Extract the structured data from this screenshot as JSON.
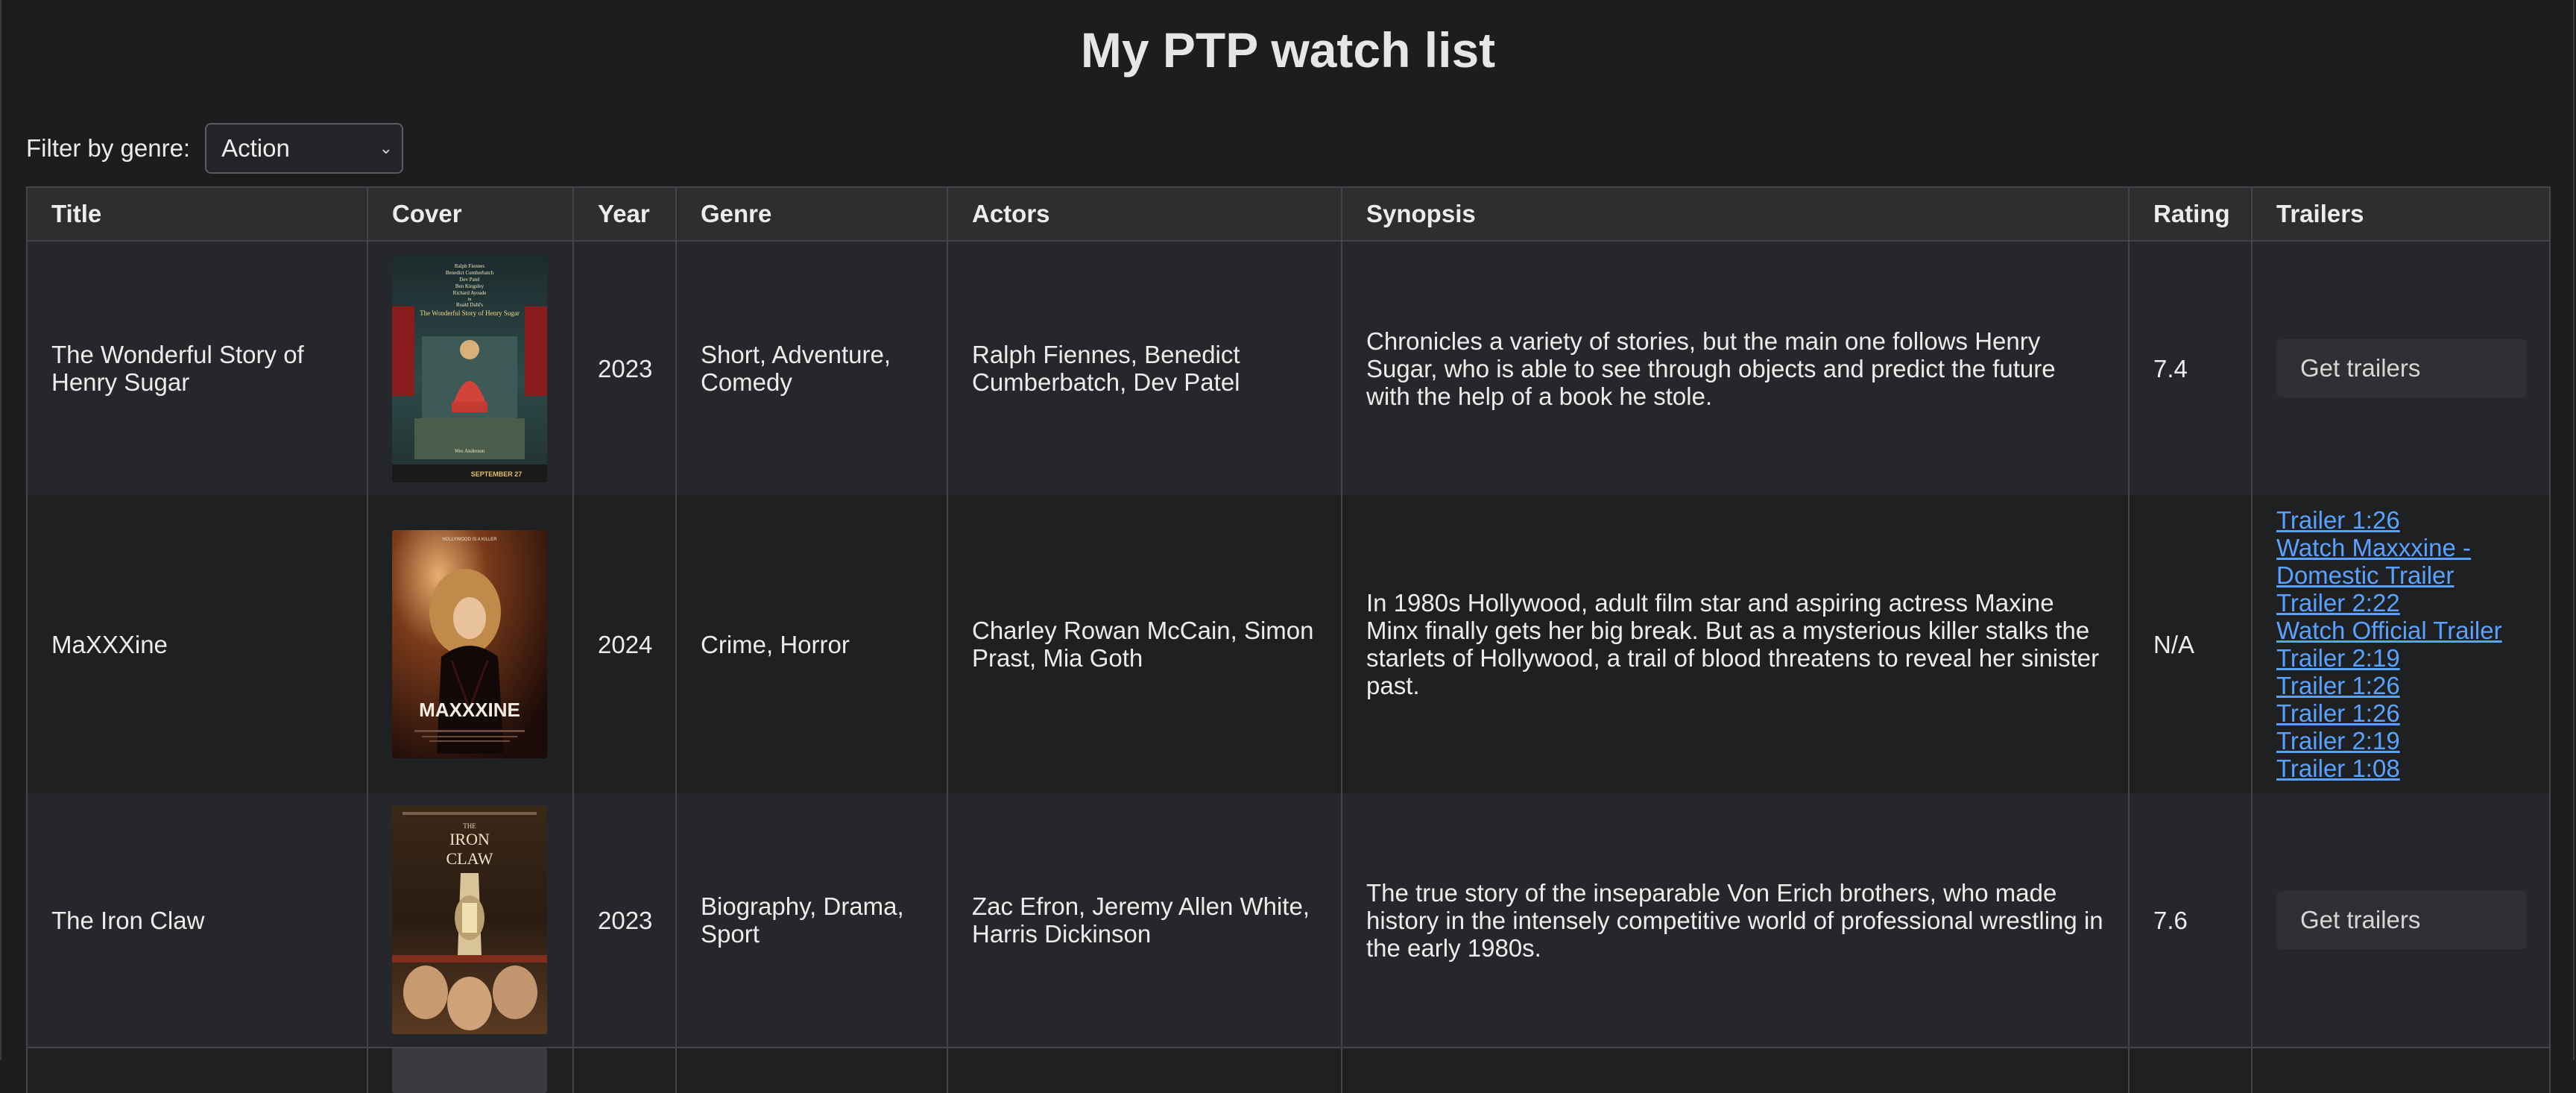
{
  "page": {
    "title": "My PTP watch list"
  },
  "filter": {
    "label": "Filter by genre:",
    "selected": "Action"
  },
  "columns": [
    "Title",
    "Cover",
    "Year",
    "Genre",
    "Actors",
    "Synopsis",
    "Rating",
    "Trailers"
  ],
  "movies": [
    {
      "title": "The Wonderful Story of Henry Sugar",
      "year": "2023",
      "genre": "Short, Adventure, Comedy",
      "actors": "Ralph Fiennes, Benedict Cumberbatch, Dev Patel",
      "synopsis": "Chronicles a variety of stories, but the main one follows Henry Sugar, who is able to see through objects and predict the future with the help of a book he stole.",
      "rating": "7.4",
      "trailer_button": "Get trailers",
      "cover_text": {
        "credits": [
          "Ralph Fiennes",
          "Benedict Cumberbatch",
          "Dev Patel",
          "Ben Kingsley",
          "Richard Ayoade",
          "in",
          "Roald Dahl's"
        ],
        "title": "The Wonderful Story of Henry Sugar",
        "director": "Wes Anderson",
        "date": "SEPTEMBER 27"
      }
    },
    {
      "title": "MaXXXine",
      "year": "2024",
      "genre": "Crime, Horror",
      "actors": "Charley Rowan McCain, Simon Prast, Mia Goth",
      "synopsis": "In 1980s Hollywood, adult film star and aspiring actress Maxine Minx finally gets her big break. But as a mysterious killer stalks the starlets of Hollywood, a trail of blood threatens to reveal her sinister past.",
      "rating": "N/A",
      "trailers": [
        "Trailer 1:26",
        "Watch Maxxxine - Domestic Trailer",
        "Trailer 2:22",
        "Watch Official Trailer",
        "Trailer 2:19",
        "Trailer 1:26",
        "Trailer 1:26",
        "Trailer 2:19",
        "Trailer 1:08"
      ],
      "cover_text": {
        "tagline": "HOLLYWOOD IS A KILLER",
        "title": "MAXXXINE"
      }
    },
    {
      "title": "The Iron Claw",
      "year": "2023",
      "genre": "Biography, Drama, Sport",
      "actors": "Zac Efron, Jeremy Allen White, Harris Dickinson",
      "synopsis": "The true story of the inseparable Von Erich brothers, who made history in the intensely competitive world of professional wrestling in the early 1980s.",
      "rating": "7.6",
      "trailer_button": "Get trailers",
      "cover_text": {
        "title_the": "THE",
        "title_iron": "IRON",
        "title_claw": "CLAW"
      }
    }
  ],
  "colors": {
    "background": "#1c1d1f",
    "header_bg": "#2d2e30",
    "link": "#5aa2ff"
  }
}
